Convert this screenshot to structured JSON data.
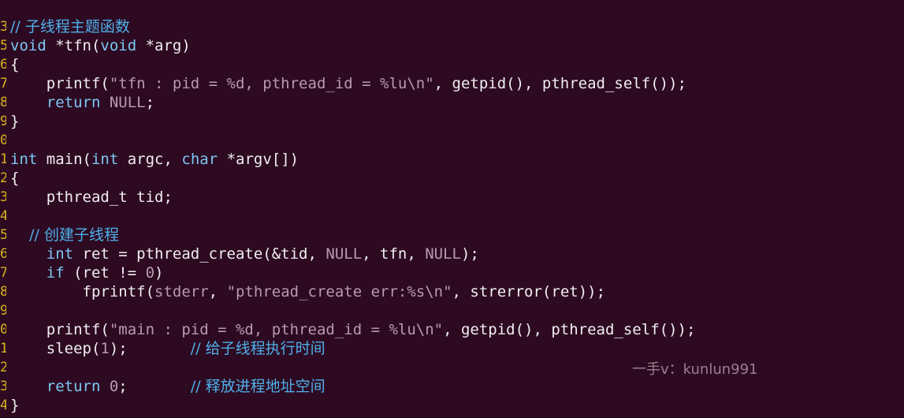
{
  "colors": {
    "background": "#2d0a22",
    "keyword": "#7fc6f2",
    "comment": "#4fb0ea",
    "literal": "#b89ab0",
    "text": "#f0eef0",
    "line_number": "#d9b41c"
  },
  "lines": [
    {
      "num": "3",
      "tokens": [
        {
          "t": "cm",
          "v": "// 子线程主题函数"
        }
      ]
    },
    {
      "num": "5",
      "tokens": [
        {
          "t": "kw",
          "v": "void"
        },
        {
          "t": "plain",
          "v": " *tfn("
        },
        {
          "t": "kw",
          "v": "void"
        },
        {
          "t": "plain",
          "v": " *arg)"
        }
      ]
    },
    {
      "num": "6",
      "tokens": [
        {
          "t": "plain",
          "v": "{"
        }
      ]
    },
    {
      "num": "7",
      "tokens": [
        {
          "t": "plain",
          "v": "    printf("
        },
        {
          "t": "str",
          "v": "\"tfn : pid = %d, pthread_id = %lu\\n\""
        },
        {
          "t": "plain",
          "v": ", getpid(), pthread_self());"
        }
      ]
    },
    {
      "num": "8",
      "tokens": [
        {
          "t": "kw",
          "v": "    return"
        },
        {
          "t": "plain",
          "v": " "
        },
        {
          "t": "lit",
          "v": "NULL"
        },
        {
          "t": "plain",
          "v": ";"
        }
      ]
    },
    {
      "num": "9",
      "tokens": [
        {
          "t": "plain",
          "v": "}"
        }
      ]
    },
    {
      "num": "0",
      "tokens": []
    },
    {
      "num": "1",
      "tokens": [
        {
          "t": "kw",
          "v": "int"
        },
        {
          "t": "plain",
          "v": " main("
        },
        {
          "t": "kw",
          "v": "int"
        },
        {
          "t": "plain",
          "v": " argc, "
        },
        {
          "t": "kw",
          "v": "char"
        },
        {
          "t": "plain",
          "v": " *argv[])"
        }
      ]
    },
    {
      "num": "2",
      "tokens": [
        {
          "t": "plain",
          "v": "{"
        }
      ]
    },
    {
      "num": "3",
      "tokens": [
        {
          "t": "plain",
          "v": "    pthread_t tid;"
        }
      ]
    },
    {
      "num": "4",
      "tokens": []
    },
    {
      "num": "5",
      "tokens": [
        {
          "t": "cm",
          "v": "    // 创建子线程"
        }
      ]
    },
    {
      "num": "6",
      "tokens": [
        {
          "t": "kw",
          "v": "    int"
        },
        {
          "t": "plain",
          "v": " ret = pthread_create(&tid, "
        },
        {
          "t": "lit",
          "v": "NULL"
        },
        {
          "t": "plain",
          "v": ", tfn, "
        },
        {
          "t": "lit",
          "v": "NULL"
        },
        {
          "t": "plain",
          "v": ");"
        }
      ]
    },
    {
      "num": "7",
      "tokens": [
        {
          "t": "kw",
          "v": "    if"
        },
        {
          "t": "plain",
          "v": " (ret != "
        },
        {
          "t": "lit",
          "v": "0"
        },
        {
          "t": "plain",
          "v": ")"
        }
      ]
    },
    {
      "num": "8",
      "tokens": [
        {
          "t": "plain",
          "v": "        fprintf("
        },
        {
          "t": "lit",
          "v": "stderr"
        },
        {
          "t": "plain",
          "v": ", "
        },
        {
          "t": "str",
          "v": "\"pthread_create err:%s\\n\""
        },
        {
          "t": "plain",
          "v": ", strerror(ret));"
        }
      ]
    },
    {
      "num": "9",
      "tokens": []
    },
    {
      "num": "0",
      "tokens": [
        {
          "t": "plain",
          "v": "    printf("
        },
        {
          "t": "str",
          "v": "\"main : pid = %d, pthread_id = %lu\\n\""
        },
        {
          "t": "plain",
          "v": ", getpid(), pthread_self());"
        }
      ]
    },
    {
      "num": "1",
      "tokens": [
        {
          "t": "plain",
          "v": "    sleep("
        },
        {
          "t": "lit",
          "v": "1"
        },
        {
          "t": "plain",
          "v": ");       "
        },
        {
          "t": "cm",
          "v": "// 给子线程执行时间"
        }
      ]
    },
    {
      "num": "2",
      "tokens": []
    },
    {
      "num": "3",
      "tokens": [
        {
          "t": "kw",
          "v": "    return"
        },
        {
          "t": "plain",
          "v": " "
        },
        {
          "t": "lit",
          "v": "0"
        },
        {
          "t": "plain",
          "v": ";       "
        },
        {
          "t": "cm",
          "v": "// 释放进程地址空间"
        }
      ]
    },
    {
      "num": "4",
      "tokens": [
        {
          "t": "plain",
          "v": "}"
        }
      ]
    }
  ],
  "watermark": "一手v：kunlun991"
}
